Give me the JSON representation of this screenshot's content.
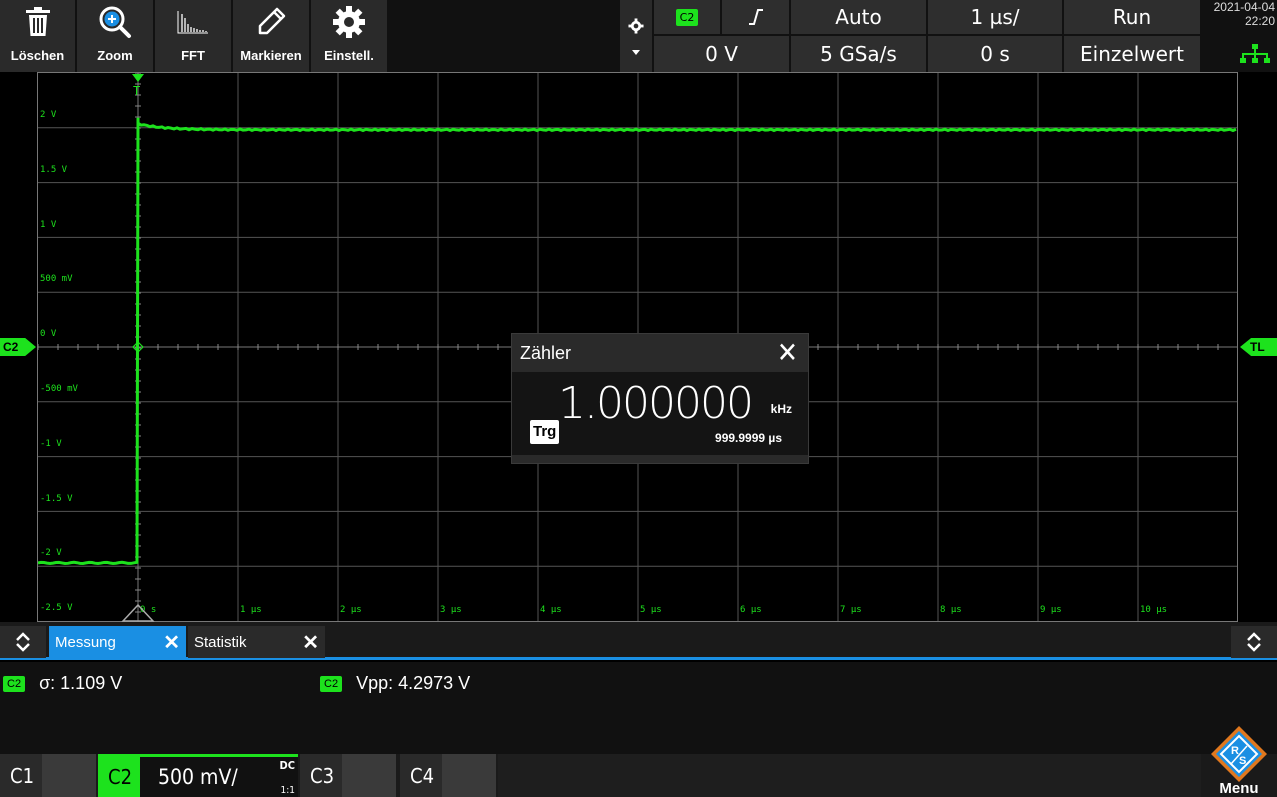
{
  "toolbar": {
    "buttons": [
      {
        "label": "Löschen",
        "icon": "trash-icon"
      },
      {
        "label": "Zoom",
        "icon": "zoom-icon"
      },
      {
        "label": "FFT",
        "icon": "fft-icon"
      },
      {
        "label": "Markieren",
        "icon": "pencil-icon"
      },
      {
        "label": "Einstell.",
        "icon": "gear-icon"
      }
    ]
  },
  "trigger": {
    "channel": "C2",
    "slope_icon": "rising-edge-icon",
    "mode": "Auto",
    "level": "0 V",
    "sample_rate": "5 GSa/s",
    "timebase": "1 µs/",
    "position": "0 s",
    "run_state": "Run",
    "acq_mode": "Einzelwert"
  },
  "datetime": {
    "date": "2021-04-04",
    "time": "22:20"
  },
  "plot": {
    "y_labels": [
      "2 V",
      "1.5 V",
      "1 V",
      "500 mV",
      "0 V",
      "-500 mV",
      "-1 V",
      "-1.5 V",
      "-2 V",
      "-2.5 V"
    ],
    "x_labels": [
      "0 s",
      "1 µs",
      "2 µs",
      "3 µs",
      "4 µs",
      "5 µs",
      "6 µs",
      "7 µs",
      "8 µs",
      "9 µs",
      "10 µs"
    ],
    "left_marker": "C2",
    "right_marker": "TL",
    "trigger_marker": "T",
    "trace_color": "#1de21d",
    "trace": {
      "low_level_v": -1.97,
      "high_level_v": 2.0,
      "step_time_us": 0
    }
  },
  "counter": {
    "title": "Zähler",
    "frequency": "1.000000",
    "frequency_unit": "kHz",
    "period": "999.9999 µs",
    "source_label": "Trg"
  },
  "tabs": [
    {
      "label": "Messung",
      "active": true
    },
    {
      "label": "Statistik",
      "active": false
    }
  ],
  "measurements": [
    {
      "channel": "C2",
      "text": "σ: 1.109 V"
    },
    {
      "channel": "C2",
      "text": "Vpp: 4.2973 V"
    }
  ],
  "channels": [
    {
      "name": "C1",
      "active": false
    },
    {
      "name": "C2",
      "active": true,
      "scale": "500 mV/",
      "coupling": "DC",
      "probe": "1:1"
    },
    {
      "name": "C3",
      "active": false
    },
    {
      "name": "C4",
      "active": false
    }
  ],
  "menu": {
    "label": "Menu"
  },
  "colors": {
    "channel": "#1de21d",
    "accent": "#1a8fe3",
    "panel": "#2a2a2a"
  }
}
